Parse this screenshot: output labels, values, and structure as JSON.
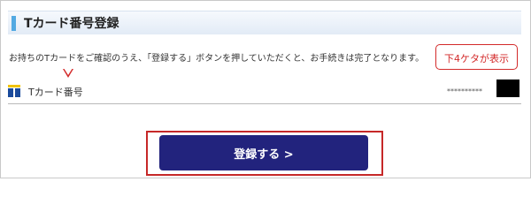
{
  "header": {
    "title": "Tカード番号登録"
  },
  "description": "お持ちのTカードをご確認のうえ、「登録する」ボタンを押していただくと、お手続きは完了となります。",
  "callout": {
    "text": "下4ケタが表示"
  },
  "tcard_row": {
    "label": "Tカード番号",
    "masked_number": "**********",
    "icon": "t-card-icon"
  },
  "register_button": {
    "label": "登録する >"
  },
  "colors": {
    "header_accent": "#52a9e2",
    "button": "#22237d",
    "callout": "#d32a2a",
    "highlight_border": "#c62828"
  }
}
